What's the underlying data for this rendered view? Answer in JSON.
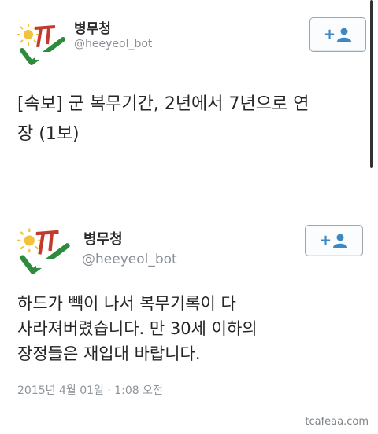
{
  "tweets": [
    {
      "account_name": "병무청",
      "handle": "@heeyeol_bot",
      "avatar_caption": "Military Manpower",
      "follow_icon": "add-user-icon",
      "text": "[속보] 군 복무기간, 2년에서 7년으로 연\n장 (1보)"
    },
    {
      "account_name": "병무청",
      "handle": "@heeyeol_bot",
      "avatar_caption": "Military Manpower",
      "follow_icon": "add-user-icon",
      "text": "하드가 빽이 나서 복무기록이 다\n사라져버렸습니다. 만 30세 이하의\n장정들은 재입대 바랍니다.",
      "timestamp": "2015년 4월 01일 · 1:08 오전"
    }
  ],
  "watermark": "tcafeaa.com",
  "colors": {
    "accent": "#3b88c3",
    "text": "#262626",
    "muted": "#8a8f95"
  }
}
